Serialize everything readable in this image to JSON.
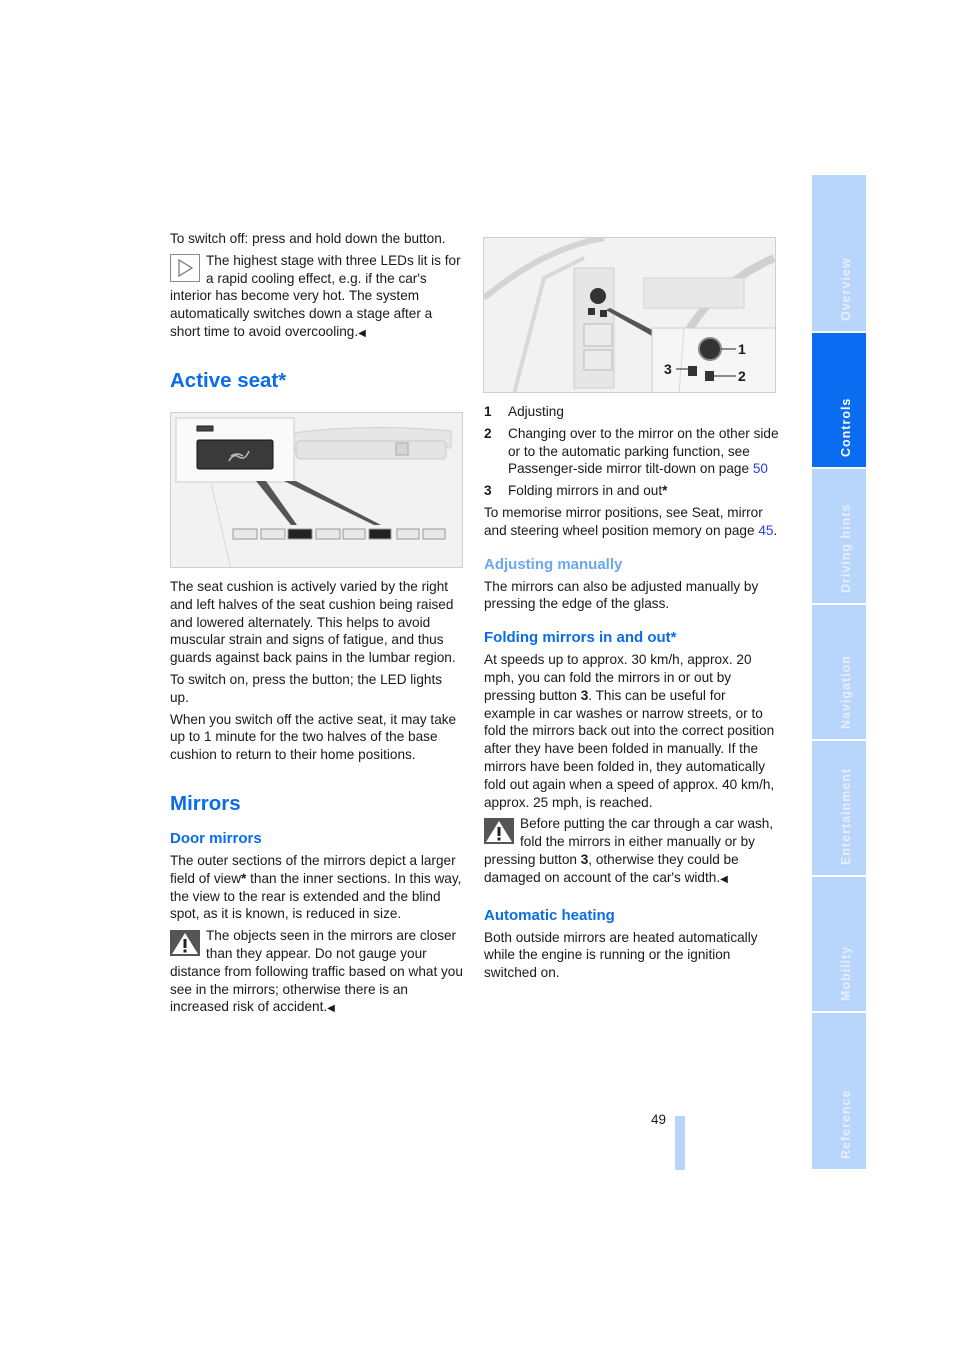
{
  "left_column": {
    "intro_text": "To switch off: press and hold down the button.",
    "tip_note": {
      "icon": "play-triangle-icon",
      "text": "The highest stage with three LEDs lit is for a rapid cooling effect, e.g. if the car's interior has become very hot. The system automatically switches down a stage after a short time to avoid overcooling."
    },
    "active_seat": {
      "title": "Active seat*",
      "figure_alt": "Active seat button in center console",
      "paragraphs": [
        "The seat cushion is actively varied by the right and left halves of the seat cushion being raised and lowered alternately. This helps to avoid muscular strain and signs of fatigue, and thus guards against back pains in the lumbar region.",
        "To switch on, press the button; the LED lights up.",
        "When you switch off the active seat, it may take up to 1 minute for the two halves of the base cushion to return to their home positions."
      ]
    },
    "mirrors": {
      "title": "Mirrors",
      "door_mirrors": {
        "title": "Door mirrors",
        "text_before": "The outer sections of the mirrors depict a larger field of view",
        "asterisk": "*",
        "text_after": " than the inner sections. In this way, the view to the rear is extended and the blind spot, as it is known, is reduced in size."
      },
      "warning_note": {
        "icon": "warning-triangle-icon",
        "text": "The objects seen in the mirrors are closer than they appear. Do not gauge your distance from following traffic based on what you see in the mirrors; otherwise there is an increased risk of accident."
      }
    }
  },
  "right_column": {
    "figure_alt": "Mirror control switches on driver door",
    "figure_callouts": [
      "1",
      "2",
      "3"
    ],
    "legend": [
      {
        "num": "1",
        "text": "Adjusting"
      },
      {
        "num": "2",
        "text": "Changing over to the mirror on the other side or to the automatic parking function, see Passenger-side mirror tilt-down on page ",
        "link": "50"
      },
      {
        "num": "3",
        "text": "Folding mirrors in and out",
        "asterisk": "*"
      }
    ],
    "memory_text": "To memorise mirror positions, see Seat, mirror and steering wheel position memory on page ",
    "memory_link": "45",
    "memory_end": ".",
    "adjusting_manually": {
      "title": "Adjusting manually",
      "text": "The mirrors can also be adjusted manually by pressing the edge of the glass."
    },
    "folding": {
      "title": "Folding mirrors in and out*",
      "text_before": "At speeds up to approx. 30 km/h, approx. 20 mph, you can fold the mirrors in or out by pressing button ",
      "bold": "3",
      "text_after": ". This can be useful for example in car washes or narrow streets, or to fold the mirrors back out into the correct position after they have been folded in manually. If the mirrors have been folded in, they automatically fold out again when a speed of approx. 40 km/h, approx. 25 mph, is reached."
    },
    "carwash_warning": {
      "icon": "warning-triangle-icon",
      "text_before": "Before putting the car through a car wash, fold the mirrors in either manually or by pressing button ",
      "bold": "3",
      "text_after": ", otherwise they could be damaged on account of the car's width."
    },
    "automatic_heating": {
      "title": "Automatic heating",
      "text": "Both outside mirrors are heated automatically while the engine is running or the ignition switched on."
    }
  },
  "sidebar": {
    "tabs": [
      {
        "label": "Overview",
        "active": false
      },
      {
        "label": "Controls",
        "active": true
      },
      {
        "label": "Driving hints",
        "active": false
      },
      {
        "label": "Navigation",
        "active": false
      },
      {
        "label": "Entertainment",
        "active": false
      },
      {
        "label": "Mobility",
        "active": false
      },
      {
        "label": "Reference",
        "active": false
      }
    ]
  },
  "footer": {
    "page_number": "49"
  },
  "colors": {
    "heading_blue": "#0a6ce8",
    "subheading_light_blue": "#6aa8f2",
    "tab_active": "#0a6cf0",
    "tab_inactive": "#b8d5fb",
    "link_blue": "#2a3fe0"
  }
}
